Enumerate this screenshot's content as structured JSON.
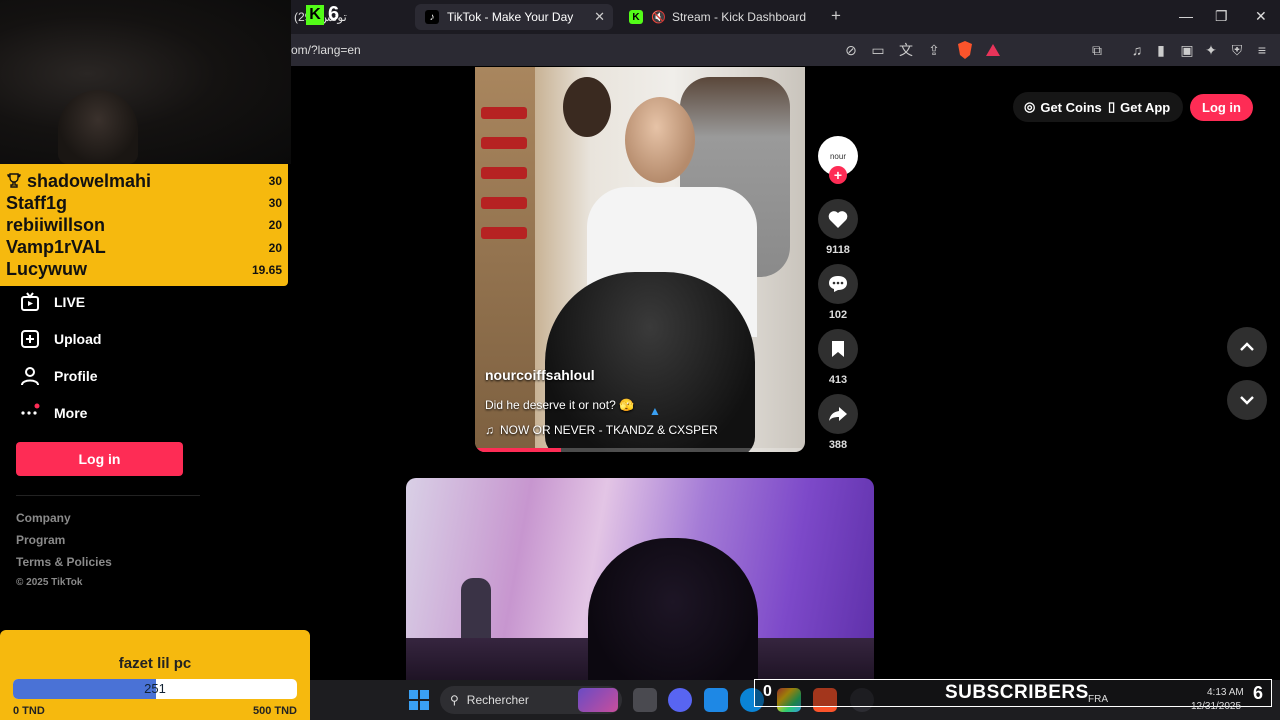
{
  "browser": {
    "tabs": [
      {
        "label": "تونس (29)",
        "favicon": "tiktok",
        "active": false
      },
      {
        "label": "TikTok - Make Your Day",
        "favicon": "tiktok",
        "active": true
      },
      {
        "label": "Stream - Kick Dashboard",
        "favicon": "kick",
        "active": false
      }
    ],
    "tab_close": "✕",
    "new_tab": "+",
    "url": "om/?lang=en"
  },
  "overlay": {
    "kick_badge_count": "6",
    "leaderboard": [
      {
        "name": "shadowelmahi",
        "value": "30",
        "trophy": true
      },
      {
        "name": "Staff1g",
        "value": "30"
      },
      {
        "name": "rebiiwillson",
        "value": "20"
      },
      {
        "name": "Vamp1rVAL",
        "value": "20"
      },
      {
        "name": "Lucywuw",
        "value": "19.65"
      }
    ],
    "goal": {
      "title": "fazet lil pc",
      "current": "251",
      "progress_fraction": 0.502,
      "min_label": "0 TND",
      "max_label": "500 TND"
    },
    "subscribers": {
      "left_count": "0",
      "label": "SUBSCRIBERS",
      "count": "6"
    }
  },
  "tiktok": {
    "sidebar": {
      "items": [
        {
          "label": "LIVE",
          "icon": "live-icon"
        },
        {
          "label": "Upload",
          "icon": "upload-icon"
        },
        {
          "label": "Profile",
          "icon": "profile-icon"
        },
        {
          "label": "More",
          "icon": "more-icon"
        }
      ],
      "login_label": "Log in",
      "footer": [
        "Company",
        "Program",
        "Terms & Policies",
        "© 2025 TikTok"
      ]
    },
    "header": {
      "get_coins": "Get Coins",
      "get_app": "Get App",
      "login": "Log in"
    },
    "video1": {
      "author": "nourcoiffsahloul",
      "caption": "Did he deserve it or not? 🫣",
      "music": "NOW OR NEVER - TKANDZ & CXSPER",
      "progress_fraction": 0.26,
      "avatar_text": "nour",
      "likes": "9118",
      "comments": "102",
      "saves": "413",
      "shares": "388"
    }
  },
  "taskbar": {
    "search_placeholder": "Rechercher",
    "language": "FRA",
    "time": "4:13 AM",
    "date": "12/31/2025"
  },
  "colors": {
    "tiktok_red": "#fe2c55",
    "overlay_yellow": "#f6b90e",
    "kick_green": "#53fc18",
    "goal_blue": "#4a72d6"
  }
}
